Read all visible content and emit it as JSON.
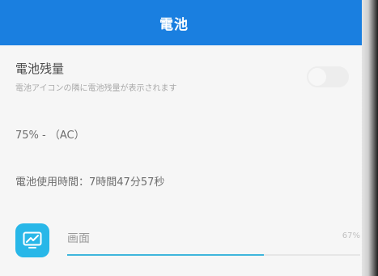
{
  "header": {
    "title": "電池",
    "color": "#1a7fe0"
  },
  "battery_percent_setting": {
    "title": "電池残量",
    "description": "電池アイコンの隣に電池残量が表示されます",
    "toggle_enabled": false
  },
  "status": {
    "text": "75% - （AC）"
  },
  "usage_time": {
    "text": "電池使用時間：7時間47分57秒"
  },
  "usage_items": [
    {
      "label": "画面",
      "percent_text": "67%",
      "fraction": 0.67,
      "icon": "screen-monitor-icon",
      "icon_color": "#28b7e8"
    }
  ]
}
